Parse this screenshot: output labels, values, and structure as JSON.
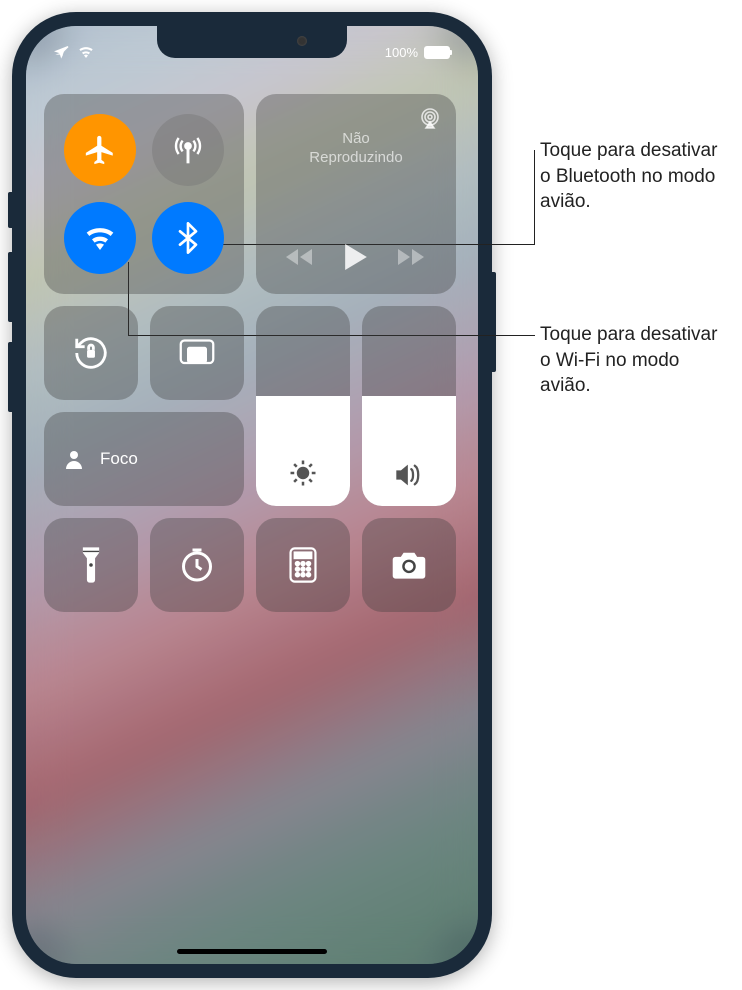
{
  "status": {
    "battery_pct": "100%"
  },
  "connectivity": {
    "airplane": true,
    "cellular": false,
    "wifi": true,
    "bluetooth": true
  },
  "media": {
    "title_line1": "Não",
    "title_line2": "Reproduzindo"
  },
  "focus": {
    "label": "Foco"
  },
  "sliders": {
    "brightness_pct": 55,
    "volume_pct": 55
  },
  "callouts": {
    "bluetooth": "Toque para desativar o Bluetooth no modo avião.",
    "wifi": "Toque para desativar o Wi‑Fi no modo avião."
  },
  "icons": {
    "airplane": "airplane-icon",
    "cellular": "cellular-antenna-icon",
    "wifi": "wifi-icon",
    "bluetooth": "bluetooth-icon",
    "airplay": "airplay-icon",
    "rewind": "rewind-icon",
    "play": "play-icon",
    "forward": "forward-icon",
    "orientation_lock": "orientation-lock-icon",
    "screen_mirroring": "screen-mirroring-icon",
    "focus_person": "focus-person-icon",
    "brightness": "brightness-icon",
    "volume": "volume-icon",
    "flashlight": "flashlight-icon",
    "timer": "timer-icon",
    "calculator": "calculator-icon",
    "camera": "camera-icon"
  }
}
